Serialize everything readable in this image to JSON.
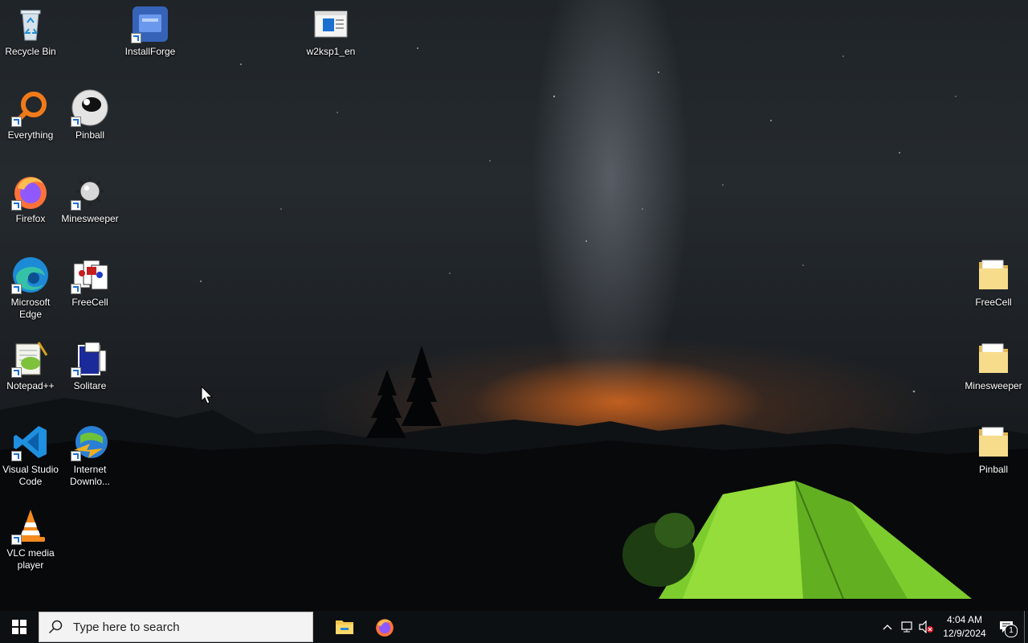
{
  "desktop": {
    "left_icons": [
      {
        "id": "recycle-bin",
        "label": "Recycle Bin",
        "icon": "recycle-bin-icon"
      },
      {
        "id": "installforge",
        "label": "InstallForge",
        "icon": "installforge-icon"
      },
      {
        "id": "w2ksp1",
        "label": "w2ksp1_en",
        "icon": "installer-window-icon"
      },
      {
        "id": "everything",
        "label": "Everything",
        "icon": "everything-search-icon"
      },
      {
        "id": "pinball",
        "label": "Pinball",
        "icon": "pinball-icon"
      },
      {
        "id": "firefox",
        "label": "Firefox",
        "icon": "firefox-icon"
      },
      {
        "id": "minesweeper",
        "label": "Minesweeper",
        "icon": "minesweeper-icon"
      },
      {
        "id": "edge",
        "label": "Microsoft Edge",
        "icon": "edge-icon"
      },
      {
        "id": "freecell",
        "label": "FreeCell",
        "icon": "freecell-icon"
      },
      {
        "id": "notepadpp",
        "label": "Notepad++",
        "icon": "notepadpp-icon"
      },
      {
        "id": "solitaire",
        "label": "Solitare",
        "icon": "solitaire-icon"
      },
      {
        "id": "vscode",
        "label": "Visual Studio Code",
        "icon": "vscode-icon"
      },
      {
        "id": "idm",
        "label": "Internet Downlo...",
        "icon": "internet-download-manager-icon"
      },
      {
        "id": "vlc",
        "label": "VLC media player",
        "icon": "vlc-icon"
      }
    ],
    "right_icons": [
      {
        "id": "folder-freecell",
        "label": "FreeCell",
        "icon": "folder-icon"
      },
      {
        "id": "folder-minesweeper",
        "label": "Minesweeper",
        "icon": "folder-icon"
      },
      {
        "id": "folder-pinball",
        "label": "Pinball",
        "icon": "folder-icon"
      }
    ]
  },
  "taskbar": {
    "start_icon": "windows-logo-icon",
    "search_placeholder": "Type here to search",
    "pinned": [
      {
        "id": "file-explorer",
        "icon": "file-explorer-icon"
      },
      {
        "id": "firefox",
        "icon": "firefox-icon"
      }
    ],
    "tray": {
      "icons": [
        "chevron-up-icon",
        "network-icon",
        "volume-muted-icon"
      ],
      "time": "4:04 AM",
      "date": "12/9/2024",
      "notification_count": "1"
    }
  },
  "colors": {
    "taskbar_bg": "#0d1012",
    "search_bg": "#f3f3f3",
    "folder_yellow": "#f4d27a"
  }
}
